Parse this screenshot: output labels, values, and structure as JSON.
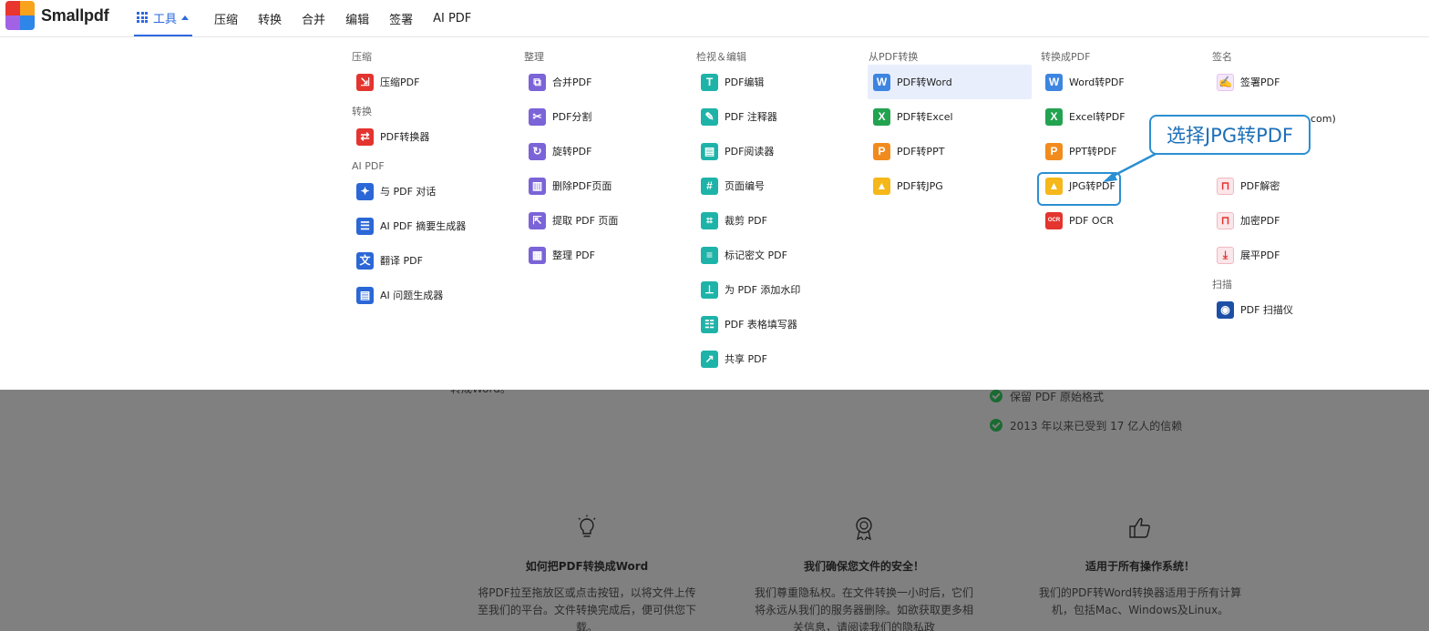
{
  "header": {
    "logo_text": "Smallpdf",
    "nav": {
      "tools_label": "工具",
      "items": [
        "压缩",
        "转换",
        "合并",
        "编辑",
        "签署",
        "AI PDF"
      ]
    }
  },
  "menu": {
    "col1": {
      "cat_compress": "压缩",
      "compress_pdf": "压缩PDF",
      "cat_convert": "转换",
      "pdf_converter": "PDF转换器",
      "cat_ai": "AI PDF",
      "chat_pdf": "与 PDF 对话",
      "ai_summary": "AI PDF 摘要生成器",
      "translate_pdf": "翻译 PDF",
      "ai_questions": "AI 问题生成器"
    },
    "col2": {
      "cat": "整理",
      "merge": "合并PDF",
      "split": "PDF分割",
      "rotate": "旋转PDF",
      "delete_pages": "删除PDF页面",
      "extract_pages": "提取 PDF 页面",
      "organize": "整理 PDF"
    },
    "col3": {
      "cat": "检视＆编辑",
      "edit": "PDF编辑",
      "annotate": "PDF 注释器",
      "reader": "PDF阅读器",
      "page_numbers": "页面编号",
      "crop": "裁剪 PDF",
      "redact": "标记密文 PDF",
      "watermark": "为 PDF 添加水印",
      "form_filler": "PDF 表格填写器",
      "share": "共享 PDF"
    },
    "col4": {
      "cat": "从PDF转换",
      "to_word": "PDF转Word",
      "to_excel": "PDF转Excel",
      "to_ppt": "PDF转PPT",
      "to_jpg": "PDF转JPG"
    },
    "col5": {
      "cat": "转换成PDF",
      "word_to_pdf": "Word转PDF",
      "excel_to_pdf": "Excel转PDF",
      "ppt_to_pdf": "PPT转PDF",
      "jpg_to_pdf": "JPG转PDF",
      "pdf_ocr": "PDF OCR"
    },
    "col6": {
      "cat_sign": "签名",
      "sign_pdf": "签署PDF",
      "partial_text": "com)",
      "unlock": "PDF解密",
      "protect": "加密PDF",
      "flatten": "展平PDF",
      "cat_scan": "扫描",
      "scanner": "PDF 扫描仪"
    }
  },
  "annotation": {
    "callout_text": "选择JPG转PDF"
  },
  "background": {
    "partial_left": "转成Word。",
    "checks": [
      "保留 PDF 原始格式",
      "2013 年以来已受到 17 亿人的信赖"
    ],
    "features": [
      {
        "icon": "lightbulb-icon",
        "title": "如何把PDF转换成Word",
        "body": "将PDF拉至拖放区或点击按钮，以将文件上传至我们的平台。文件转换完成后，便可供您下载。"
      },
      {
        "icon": "award-icon",
        "title": "我们确保您文件的安全！",
        "body": "我们尊重隐私权。在文件转换一小时后，它们将永远从我们的服务器删除。如欲获取更多相关信息，请阅读我们的隐私政"
      },
      {
        "icon": "thumbs-up-icon",
        "title": "适用于所有操作系统！",
        "body": "我们的PDF转Word转换器适用于所有计算机，包括Mac、Windows及Linux。"
      }
    ]
  },
  "colors": {
    "accent": "#2d6ae0",
    "annotation": "#2b8fd3",
    "overlay": "#808080"
  }
}
